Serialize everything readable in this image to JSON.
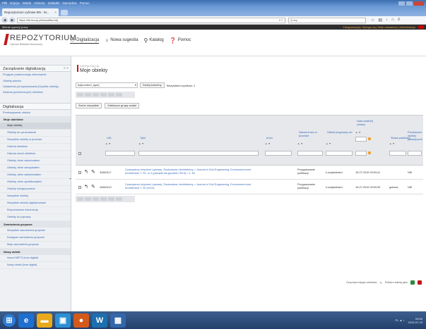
{
  "browser": {
    "menu": [
      "Plik",
      "Edycja",
      "Widok",
      "Historia",
      "Zakładki",
      "Narzędzia",
      "Pomoc"
    ],
    "tab_title": "Repozytorium cyfrowe BN - M...",
    "tab_close": "×",
    "url": "https://dlr.itcorp.pl/bwsd/ftsr/obj",
    "url_right": "▾ C",
    "search": "Q ary",
    "bookmark_label": "Mibrak agencji pracy",
    "user_info": "Zalogowany(a): Wyloguj się | Moje ustawienia | Administracja"
  },
  "header": {
    "logo_title": "REPOZYTORIUM",
    "logo_sub": "Cyfrowe Biblioteki Narodowej",
    "nav": [
      {
        "label": "Digitalizacja",
        "icon": "people-icon"
      },
      {
        "label": "Nowa sugestia",
        "icon": "lightbulb-icon"
      },
      {
        "label": "Katalog",
        "icon": "search-icon"
      },
      {
        "label": "Pomoc",
        "icon": "help-icon"
      }
    ]
  },
  "sidebar": {
    "section1": "Zarządzanie digitalizacją",
    "section1_links": [
      "Przyjęcie powierzonego zbiorowania",
      "Obiekty planów",
      "Ustawienia pól wyszukiwania (Szybkie obiekty)",
      "Zadania (powierzonych) obiektów"
    ],
    "section2": "Digitalizacja",
    "section2_link": "Przekazywanie obiektu",
    "group1": "Moje obiektów",
    "group1_items": [
      "Moje obiekty",
      "Obiekty do opracowania",
      "Wszystkie obiekty w procesie",
      "Historia obiektów",
      "Historia moich obiektów",
      "Obiekty, które zakończałem",
      "Obiekty, które zarządzałem",
      "Obiekty, które zatwierdzałem",
      "Obiekty, które opublikowałem",
      "Obiekty niezgrupowane",
      "Wszystkie obiekty",
      "Wszystkie obiekty digitalizowane",
      "Eksportowane dokumenty",
      "Obiekty do poprawy"
    ],
    "group2": "Zamówienia grupowe",
    "group2_items": [
      "Wszystkie zamówienia grupowe",
      "Dostępne zamówienia grupowe",
      "Moje zamówienia grupowe"
    ],
    "group3": "Nowy obiekt",
    "group3_items": [
      "Import METS (inne digital)",
      "Nowy obiekt (inne digital)"
    ]
  },
  "main": {
    "breadcrumb": "DIGITALIZACJA",
    "title": "Moje obiekty",
    "select_value": "byt[content_type]",
    "add_button": "Dodaj kolumnę",
    "found": "Wszystkich wyników: 2",
    "action1": "Zwróć wszystkie",
    "action2": "Zakleszcz grupę zadań",
    "columns": {
      "uid": "UID",
      "title": "Tytuł",
      "author": "Autor",
      "process_name": "Nazwa kroku w procesie",
      "assigned": "Obiekt przypisany do",
      "date_modified": "Data ostatniej zmiany",
      "publish_status": "Status publikacji",
      "transferred": "Przekazane obiekty planistyczne"
    },
    "sort_label": "▲ ▼",
    "sort_label_short": "↕",
    "rows": [
      {
        "uid": "34560117",
        "title": "Czasopismo Inżynierii Lądowej, Środowiska i Architektury = Journal of Civil Engineering, Environment and Architecture T. 30, nr 4 (październik-grudzień 2013) = z. 60",
        "author": "",
        "process": "Przygotowanie publikacji",
        "assigned": "k.szajdziewicz",
        "date": "15-07-2015 09:53:41",
        "status": "",
        "transferred": "NIE"
      },
      {
        "uid": "34560119",
        "title": "Czasopismo Inżynierii Lądowej, Środowiska i Architektury = Journal of Civil Engineering, Environment and Architecture T. 30 (2013)",
        "author": "",
        "process": "Przygotowanie publikacji",
        "assigned": "k.szajdziewicz",
        "date": "15-07-2015 09:53:39",
        "status": "gotowa",
        "transferred": "NIE"
      }
    ],
    "footer_link1": "Grupowa edycja obiektów",
    "footer_link2": "Pobierz tabelę jako"
  },
  "taskbar": {
    "clock_time": "09:55",
    "clock_date": "2015-07-15",
    "tray": "PL ▲ ♪"
  }
}
